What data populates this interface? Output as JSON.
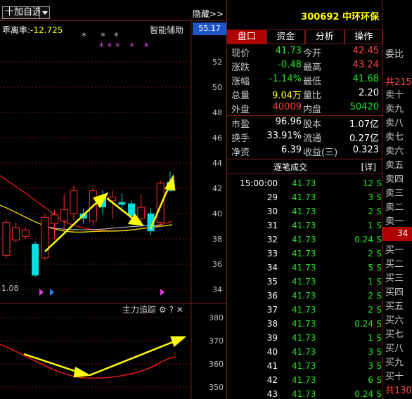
{
  "toolbar": {
    "add_label": "十加自选",
    "hide_label": "隐藏>>"
  },
  "indicator": {
    "bias_name": "乖离率:",
    "bias_value": "-12.725",
    "smart_label": "智能辅助",
    "stars_top": "*     *   *",
    "stars_pink": "* * *   *   *"
  },
  "price_box": "55.17",
  "left_value": "1.08",
  "sub_indicator": {
    "label": "主力追踪",
    "settings_icon": "gear-icon",
    "help": "?",
    "close": "✕"
  },
  "y_axis_main": [
    "52",
    "50",
    "48",
    "46",
    "44",
    "42",
    "40",
    "38",
    "36",
    "34"
  ],
  "y_axis_sub": [
    "380",
    "370",
    "360",
    "350"
  ],
  "stock": {
    "code": "300692",
    "name": "中环环保"
  },
  "tabs": [
    "盘口",
    "资金",
    "分析",
    "操作"
  ],
  "quote": {
    "r1": {
      "l1": "现价",
      "v1": "41.73",
      "l2": "今开",
      "v2": "42.45"
    },
    "r2": {
      "l1": "涨跌",
      "v1": "-0.48",
      "l2": "最高",
      "v2": "43.24"
    },
    "r3": {
      "l1": "涨幅",
      "v1": "-1.14%",
      "l2": "最低",
      "v2": "41.68"
    },
    "r4": {
      "l1": "总量",
      "v1": "9.04万",
      "l2": "量比",
      "v2": "2.20"
    },
    "r5": {
      "l1": "外盘",
      "v1": "40009",
      "l2": "内盘",
      "v2": "50420"
    },
    "r6": {
      "l1": "市盈",
      "v1": "96.96",
      "l2": "股本",
      "v2": "1.07亿"
    },
    "r7": {
      "l1": "换手",
      "v1": "33.91%",
      "l2": "流通",
      "v2": "0.27亿"
    },
    "r8": {
      "l1": "净资",
      "v1": "6.39",
      "l2": "收益(三)",
      "v2": "0.323"
    }
  },
  "trades_header": {
    "title": "逐笔成交",
    "detail": "[详]"
  },
  "trades": [
    {
      "time": "15:00:00",
      "price": "41.73",
      "vol": "12",
      "dir": "S"
    },
    {
      "time": "29",
      "price": "41.73",
      "vol": "3",
      "dir": "S"
    },
    {
      "time": "30",
      "price": "41.73",
      "vol": "2",
      "dir": "S"
    },
    {
      "time": "31",
      "price": "41.73",
      "vol": "1",
      "dir": "S"
    },
    {
      "time": "32",
      "price": "41.73",
      "vol": "0.24",
      "dir": "S"
    },
    {
      "time": "33",
      "price": "41.73",
      "vol": "2",
      "dir": "S"
    },
    {
      "time": "34",
      "price": "41.73",
      "vol": "5",
      "dir": "S"
    },
    {
      "time": "35",
      "price": "41.73",
      "vol": "1",
      "dir": "S"
    },
    {
      "time": "36",
      "price": "41.73",
      "vol": "2",
      "dir": "S"
    },
    {
      "time": "37",
      "price": "41.73",
      "vol": "2",
      "dir": "S"
    },
    {
      "time": "38",
      "price": "41.73",
      "vol": "0.24",
      "dir": "S"
    },
    {
      "time": "39",
      "price": "41.73",
      "vol": "1",
      "dir": "S"
    },
    {
      "time": "40",
      "price": "41.73",
      "vol": "3",
      "dir": "S"
    },
    {
      "time": "41",
      "price": "41.73",
      "vol": "3",
      "dir": "S"
    },
    {
      "time": "42",
      "price": "41.73",
      "vol": "6",
      "dir": "S"
    },
    {
      "time": "43",
      "price": "41.73",
      "vol": "0.24",
      "dir": "S"
    }
  ],
  "book": {
    "weibi": "委比",
    "sell_total": "共215",
    "sells": [
      "卖十",
      "卖九",
      "卖八",
      "卖七",
      "卖六",
      "卖五",
      "卖四",
      "卖三",
      "卖二",
      "卖一"
    ],
    "mid": "34",
    "buys": [
      "买一",
      "买二",
      "买三",
      "买四",
      "买五",
      "买六",
      "买七",
      "买八",
      "买九",
      "买十"
    ],
    "buy_total": "共130"
  },
  "colors": {
    "up": "#ff4545",
    "down": "#1ee81e",
    "accent_bg": "#b00000",
    "axis_grid": "#7a1a1a",
    "annotation": "#ffff00"
  },
  "candles": [
    {
      "o": 36.7,
      "c": 39.3,
      "h": 39.5,
      "l": 36.5,
      "up": true
    },
    {
      "o": 37.9,
      "c": 38.9,
      "h": 39.3,
      "l": 37.7,
      "up": true
    },
    {
      "o": 38.2,
      "c": 38.7,
      "h": 38.9,
      "l": 38.0,
      "up": true
    },
    {
      "o": 37.6,
      "c": 35.1,
      "h": 37.8,
      "l": 35.0,
      "up": false
    },
    {
      "o": 36.5,
      "c": 39.7,
      "h": 40.0,
      "l": 36.3,
      "up": true
    },
    {
      "o": 39.2,
      "c": 39.9,
      "h": 40.3,
      "l": 38.0,
      "up": true
    },
    {
      "o": 39.4,
      "c": 40.3,
      "h": 41.5,
      "l": 38.8,
      "up": true
    },
    {
      "o": 40.0,
      "c": 41.8,
      "h": 42.2,
      "l": 39.5,
      "up": true
    },
    {
      "o": 40.0,
      "c": 39.6,
      "h": 40.4,
      "l": 39.2,
      "up": false
    },
    {
      "o": 39.4,
      "c": 41.8,
      "h": 42.0,
      "l": 39.0,
      "up": true
    },
    {
      "o": 41.3,
      "c": 40.5,
      "h": 41.8,
      "l": 40.0,
      "up": false
    },
    {
      "o": 41.0,
      "c": 41.3,
      "h": 41.8,
      "l": 39.6,
      "up": true
    },
    {
      "o": 40.9,
      "c": 40.7,
      "h": 41.6,
      "l": 40.1,
      "up": false
    },
    {
      "o": 40.8,
      "c": 39.8,
      "h": 41.0,
      "l": 39.4,
      "up": false
    },
    {
      "o": 39.6,
      "c": 40.5,
      "h": 41.5,
      "l": 39.3,
      "up": true
    },
    {
      "o": 40.0,
      "c": 38.6,
      "h": 40.4,
      "l": 38.3,
      "up": false
    },
    {
      "o": 39.3,
      "c": 42.4,
      "h": 42.6,
      "l": 39.1,
      "up": true
    },
    {
      "o": 42.5,
      "c": 41.8,
      "h": 43.3,
      "l": 41.7,
      "up": false
    }
  ]
}
